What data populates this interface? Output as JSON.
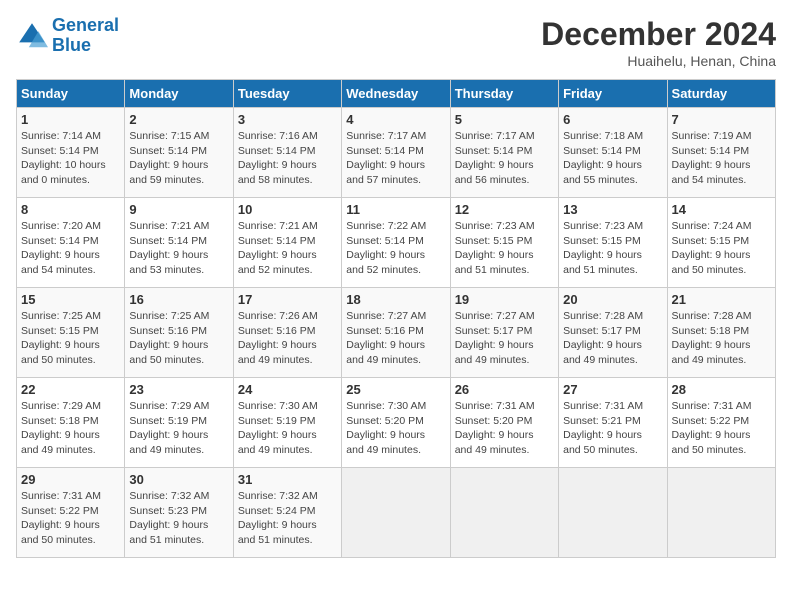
{
  "header": {
    "logo_line1": "General",
    "logo_line2": "Blue",
    "month": "December 2024",
    "location": "Huaihelu, Henan, China"
  },
  "days_of_week": [
    "Sunday",
    "Monday",
    "Tuesday",
    "Wednesday",
    "Thursday",
    "Friday",
    "Saturday"
  ],
  "weeks": [
    [
      {
        "num": "1",
        "info": "Sunrise: 7:14 AM\nSunset: 5:14 PM\nDaylight: 10 hours\nand 0 minutes."
      },
      {
        "num": "2",
        "info": "Sunrise: 7:15 AM\nSunset: 5:14 PM\nDaylight: 9 hours\nand 59 minutes."
      },
      {
        "num": "3",
        "info": "Sunrise: 7:16 AM\nSunset: 5:14 PM\nDaylight: 9 hours\nand 58 minutes."
      },
      {
        "num": "4",
        "info": "Sunrise: 7:17 AM\nSunset: 5:14 PM\nDaylight: 9 hours\nand 57 minutes."
      },
      {
        "num": "5",
        "info": "Sunrise: 7:17 AM\nSunset: 5:14 PM\nDaylight: 9 hours\nand 56 minutes."
      },
      {
        "num": "6",
        "info": "Sunrise: 7:18 AM\nSunset: 5:14 PM\nDaylight: 9 hours\nand 55 minutes."
      },
      {
        "num": "7",
        "info": "Sunrise: 7:19 AM\nSunset: 5:14 PM\nDaylight: 9 hours\nand 54 minutes."
      }
    ],
    [
      {
        "num": "8",
        "info": "Sunrise: 7:20 AM\nSunset: 5:14 PM\nDaylight: 9 hours\nand 54 minutes."
      },
      {
        "num": "9",
        "info": "Sunrise: 7:21 AM\nSunset: 5:14 PM\nDaylight: 9 hours\nand 53 minutes."
      },
      {
        "num": "10",
        "info": "Sunrise: 7:21 AM\nSunset: 5:14 PM\nDaylight: 9 hours\nand 52 minutes."
      },
      {
        "num": "11",
        "info": "Sunrise: 7:22 AM\nSunset: 5:14 PM\nDaylight: 9 hours\nand 52 minutes."
      },
      {
        "num": "12",
        "info": "Sunrise: 7:23 AM\nSunset: 5:15 PM\nDaylight: 9 hours\nand 51 minutes."
      },
      {
        "num": "13",
        "info": "Sunrise: 7:23 AM\nSunset: 5:15 PM\nDaylight: 9 hours\nand 51 minutes."
      },
      {
        "num": "14",
        "info": "Sunrise: 7:24 AM\nSunset: 5:15 PM\nDaylight: 9 hours\nand 50 minutes."
      }
    ],
    [
      {
        "num": "15",
        "info": "Sunrise: 7:25 AM\nSunset: 5:15 PM\nDaylight: 9 hours\nand 50 minutes."
      },
      {
        "num": "16",
        "info": "Sunrise: 7:25 AM\nSunset: 5:16 PM\nDaylight: 9 hours\nand 50 minutes."
      },
      {
        "num": "17",
        "info": "Sunrise: 7:26 AM\nSunset: 5:16 PM\nDaylight: 9 hours\nand 49 minutes."
      },
      {
        "num": "18",
        "info": "Sunrise: 7:27 AM\nSunset: 5:16 PM\nDaylight: 9 hours\nand 49 minutes."
      },
      {
        "num": "19",
        "info": "Sunrise: 7:27 AM\nSunset: 5:17 PM\nDaylight: 9 hours\nand 49 minutes."
      },
      {
        "num": "20",
        "info": "Sunrise: 7:28 AM\nSunset: 5:17 PM\nDaylight: 9 hours\nand 49 minutes."
      },
      {
        "num": "21",
        "info": "Sunrise: 7:28 AM\nSunset: 5:18 PM\nDaylight: 9 hours\nand 49 minutes."
      }
    ],
    [
      {
        "num": "22",
        "info": "Sunrise: 7:29 AM\nSunset: 5:18 PM\nDaylight: 9 hours\nand 49 minutes."
      },
      {
        "num": "23",
        "info": "Sunrise: 7:29 AM\nSunset: 5:19 PM\nDaylight: 9 hours\nand 49 minutes."
      },
      {
        "num": "24",
        "info": "Sunrise: 7:30 AM\nSunset: 5:19 PM\nDaylight: 9 hours\nand 49 minutes."
      },
      {
        "num": "25",
        "info": "Sunrise: 7:30 AM\nSunset: 5:20 PM\nDaylight: 9 hours\nand 49 minutes."
      },
      {
        "num": "26",
        "info": "Sunrise: 7:31 AM\nSunset: 5:20 PM\nDaylight: 9 hours\nand 49 minutes."
      },
      {
        "num": "27",
        "info": "Sunrise: 7:31 AM\nSunset: 5:21 PM\nDaylight: 9 hours\nand 50 minutes."
      },
      {
        "num": "28",
        "info": "Sunrise: 7:31 AM\nSunset: 5:22 PM\nDaylight: 9 hours\nand 50 minutes."
      }
    ],
    [
      {
        "num": "29",
        "info": "Sunrise: 7:31 AM\nSunset: 5:22 PM\nDaylight: 9 hours\nand 50 minutes."
      },
      {
        "num": "30",
        "info": "Sunrise: 7:32 AM\nSunset: 5:23 PM\nDaylight: 9 hours\nand 51 minutes."
      },
      {
        "num": "31",
        "info": "Sunrise: 7:32 AM\nSunset: 5:24 PM\nDaylight: 9 hours\nand 51 minutes."
      },
      null,
      null,
      null,
      null
    ]
  ]
}
